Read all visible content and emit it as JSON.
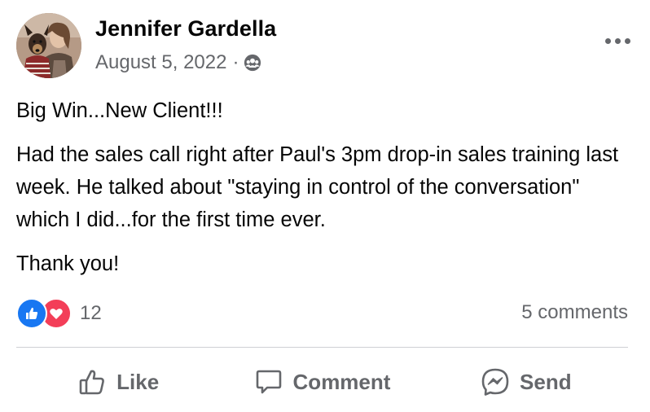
{
  "post": {
    "author": "Jennifer Gardella",
    "date": "August 5, 2022",
    "separator": "·",
    "audience_icon": "group-audience-icon",
    "paragraphs": {
      "p1": "Big Win...New Client!!!",
      "p2": "Had the sales call right after Paul's 3pm drop-in sales training last week.  He talked about \"staying in control of the conversation\" which I did...for the first time ever.",
      "p3": "Thank you!"
    }
  },
  "stats": {
    "reaction_count": "12",
    "reaction_icons": [
      "like-reaction-icon",
      "love-reaction-icon"
    ],
    "comments_label": "5 comments"
  },
  "actions": {
    "like_label": "Like",
    "comment_label": "Comment",
    "send_label": "Send"
  },
  "colors": {
    "like_blue": "#1877f2",
    "love_red": "#f33e58",
    "secondary_text": "#65676b"
  }
}
